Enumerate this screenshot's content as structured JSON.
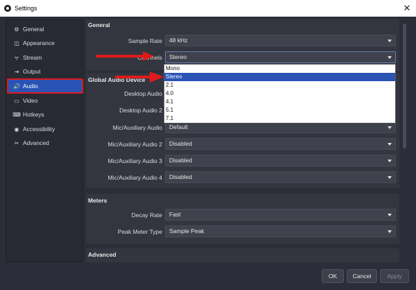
{
  "window": {
    "title": "Settings",
    "close_glyph": "✕"
  },
  "sidebar": {
    "items": [
      {
        "id": "general",
        "label": "General",
        "icon": "gear-icon",
        "glyph": "⚙"
      },
      {
        "id": "appearance",
        "label": "Appearance",
        "icon": "appearance-icon",
        "glyph": "◫"
      },
      {
        "id": "stream",
        "label": "Stream",
        "icon": "stream-icon",
        "glyph": "ᯤ"
      },
      {
        "id": "output",
        "label": "Output",
        "icon": "output-icon",
        "glyph": "⇥"
      },
      {
        "id": "audio",
        "label": "Audio",
        "icon": "speaker-icon",
        "glyph": "🔊",
        "active": true
      },
      {
        "id": "video",
        "label": "Video",
        "icon": "monitor-icon",
        "glyph": "▭"
      },
      {
        "id": "hotkeys",
        "label": "Hotkeys",
        "icon": "keyboard-icon",
        "glyph": "⌨"
      },
      {
        "id": "accessibility",
        "label": "Accessibility",
        "icon": "accessibility-icon",
        "glyph": "◉"
      },
      {
        "id": "advanced",
        "label": "Advanced",
        "icon": "tools-icon",
        "glyph": "✂"
      }
    ]
  },
  "general_group": {
    "title": "General",
    "sample_rate": {
      "label": "Sample Rate",
      "value": "48 kHz"
    },
    "channels": {
      "label": "Channels",
      "value": "Stereo"
    }
  },
  "global_audio": {
    "title": "Global Audio Device",
    "desktop_audio": {
      "label": "Desktop Audio"
    },
    "desktop_audio_2": {
      "label": "Desktop Audio 2"
    },
    "mic_1": {
      "label": "Mic/Auxiliary Audio",
      "value": "Default"
    },
    "mic_2": {
      "label": "Mic/Auxiliary Audio 2",
      "value": "Disabled"
    },
    "mic_3": {
      "label": "Mic/Auxiliary Audio 3",
      "value": "Disabled"
    },
    "mic_4": {
      "label": "Mic/Auxiliary Audio 4",
      "value": "Disabled"
    }
  },
  "meters": {
    "title": "Meters",
    "decay_rate": {
      "label": "Decay Rate",
      "value": "Fast"
    },
    "peak_meter_type": {
      "label": "Peak Meter Type",
      "value": "Sample Peak"
    }
  },
  "advanced_group": {
    "title": "Advanced"
  },
  "channels_dropdown": {
    "options": [
      "Mono",
      "Stereo",
      "2.1",
      "4.0",
      "4.1",
      "5.1",
      "7.1"
    ],
    "selected": "Stereo"
  },
  "buttons": {
    "ok": "OK",
    "cancel": "Cancel",
    "apply": "Apply"
  },
  "colors": {
    "accent": "#2a53b5",
    "highlight_border": "#e01a1a",
    "annotation_arrow": "#e01a1a",
    "background": "#2b2e38"
  }
}
